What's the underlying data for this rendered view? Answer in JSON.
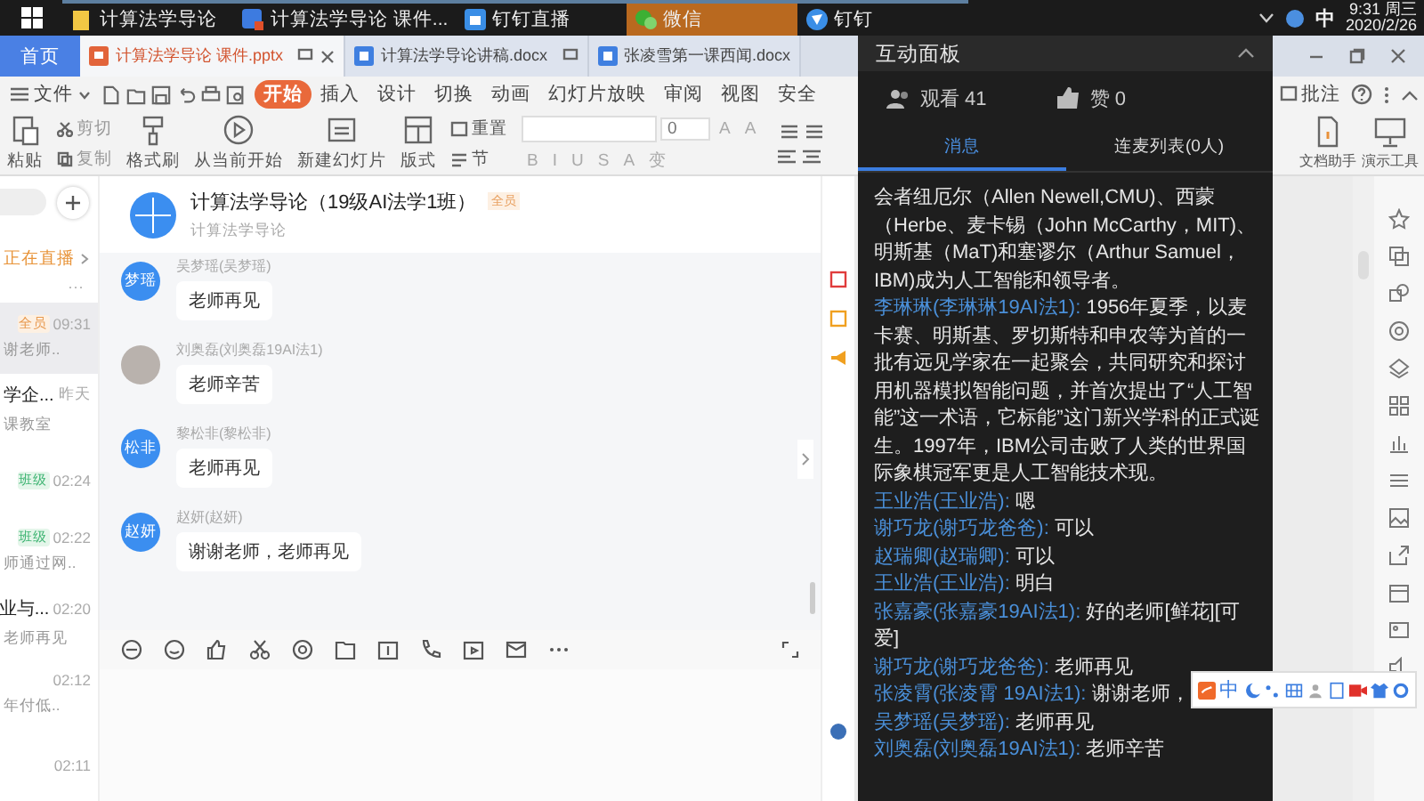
{
  "taskbar": {
    "items": [
      {
        "label": "计算法学导论",
        "kind": "folder",
        "selected": false
      },
      {
        "label": "计算法学导论 课件...",
        "kind": "wps",
        "selected": false
      },
      {
        "label": "钉钉直播",
        "kind": "live",
        "selected": false
      },
      {
        "label": "微信",
        "kind": "wechat",
        "selected": true
      },
      {
        "label": "钉钉",
        "kind": "dingtalk",
        "selected": false
      }
    ],
    "ime": "中",
    "time": "9:31 周三",
    "date": "2020/2/26"
  },
  "wps": {
    "home": "首页",
    "doc_tabs": [
      {
        "label": "计算法学导论 课件.pptx",
        "kind": "pptx",
        "selected": true
      },
      {
        "label": "计算法学导论讲稿.docx",
        "kind": "docx",
        "selected": false
      },
      {
        "label": "张凌雪第一课西闻.docx",
        "kind": "docx",
        "selected": false
      }
    ],
    "file_menu": "文件",
    "menu": [
      {
        "label": "开始",
        "selected": true
      },
      {
        "label": "插入",
        "selected": false
      },
      {
        "label": "设计",
        "selected": false
      },
      {
        "label": "切换",
        "selected": false
      },
      {
        "label": "动画",
        "selected": false
      },
      {
        "label": "幻灯片放映",
        "selected": false
      },
      {
        "label": "审阅",
        "selected": false
      },
      {
        "label": "视图",
        "selected": false
      },
      {
        "label": "安全",
        "selected": false
      }
    ],
    "comment": "批注",
    "ribbon": {
      "paste": "粘贴",
      "cut": "剪切",
      "copy": "复制",
      "format_painter": "格式刷",
      "play_from_current": "从当前开始",
      "new_slide": "新建幻灯片",
      "layout": "版式",
      "reset": "重置",
      "section": "节",
      "font_size": "0",
      "size_buttons": [
        "A",
        "A"
      ],
      "format_buttons": [
        "B",
        "I",
        "U",
        "S",
        "A"
      ],
      "text_effect": "变",
      "doc_helper": "文档助手",
      "present_tools": "演示工具"
    }
  },
  "chat_list": {
    "live": "正在直播",
    "more": "···",
    "items": [
      {
        "tag": "全员",
        "time": "09:31",
        "preview": "谢老师..",
        "selected": true
      },
      {
        "title": "学企...",
        "time": "昨天",
        "preview": "课教室",
        "selected": false
      },
      {
        "tag": "班级",
        "time": "02:24",
        "selected": false
      },
      {
        "tag": "班级",
        "time": "02:22",
        "preview": "师通过网..",
        "selected": false
      },
      {
        "title": "业与...",
        "time": "02:20",
        "preview": "老师再见",
        "selected": false
      },
      {
        "time": "02:12",
        "preview": "年付低..",
        "selected": false
      },
      {
        "time": "02:11",
        "selected": false
      }
    ]
  },
  "chat": {
    "title": "计算法学导论（19级AI法学1班）",
    "badge": "全员",
    "subtitle": "计算法学导论",
    "messages": [
      {
        "kind": "text",
        "avatar_label": "梦瑶",
        "sender": "吴梦瑶(吴梦瑶)",
        "text": "老师再见"
      },
      {
        "kind": "photo",
        "sender": "刘奥磊(刘奥磊19AI法1)",
        "text": "老师辛苦"
      },
      {
        "kind": "text",
        "avatar_label": "松非",
        "sender": "黎松非(黎松非)",
        "text": "老师再见"
      },
      {
        "kind": "text",
        "avatar_label": "赵妍",
        "sender": "赵妍(赵妍)",
        "text": "谢谢老师，老师再见"
      }
    ]
  },
  "live_panel": {
    "title": "互动面板",
    "viewers": "观看 41",
    "likes": "赞 0",
    "tabs": [
      {
        "label": "消息",
        "selected": true
      },
      {
        "label": "连麦列表(0人)",
        "selected": false
      }
    ],
    "messages": [
      {
        "text": "会者纽厄尔（Allen Newell,CMU)、西蒙（Herbe、麦卡锡（John McCarthy，MIT)、明斯基（MaT)和塞谬尔（Arthur Samuel，IBM)成为人工智能和领导者。"
      },
      {
        "name": "李琳琳(李琳琳19AI法1):",
        "text": "1956年夏季，以麦卡赛、明斯基、罗切斯特和申农等为首的一批有远见学家在一起聚会，共同研究和探讨用机器模拟智能问题，并首次提出了“人工智能”这一术语，它标能”这门新兴学科的正式诞生。1997年，IBM公司击败了人类的世界国际象棋冠军更是人工智能技术现。"
      },
      {
        "name": "王业浩(王业浩):",
        "text": "嗯"
      },
      {
        "name": "谢巧龙(谢巧龙爸爸):",
        "text": "可以"
      },
      {
        "name": "赵瑞卿(赵瑞卿):",
        "text": "可以"
      },
      {
        "name": "王业浩(王业浩):",
        "text": "明白"
      },
      {
        "name": "张嘉豪(张嘉豪19AI法1):",
        "text": "好的老师[鲜花][可爱]"
      },
      {
        "name": "谢巧龙(谢巧龙爸爸):",
        "text": "老师再见"
      },
      {
        "name": "张凌霄(张凌霄 19AI法1):",
        "text": "谢谢老师，"
      },
      {
        "name": "吴梦瑶(吴梦瑶):",
        "text": "老师再见"
      },
      {
        "name": "刘奥磊(刘奥磊19AI法1):",
        "text": "老师辛苦"
      }
    ]
  },
  "ime_bar": {
    "mode": "中"
  }
}
